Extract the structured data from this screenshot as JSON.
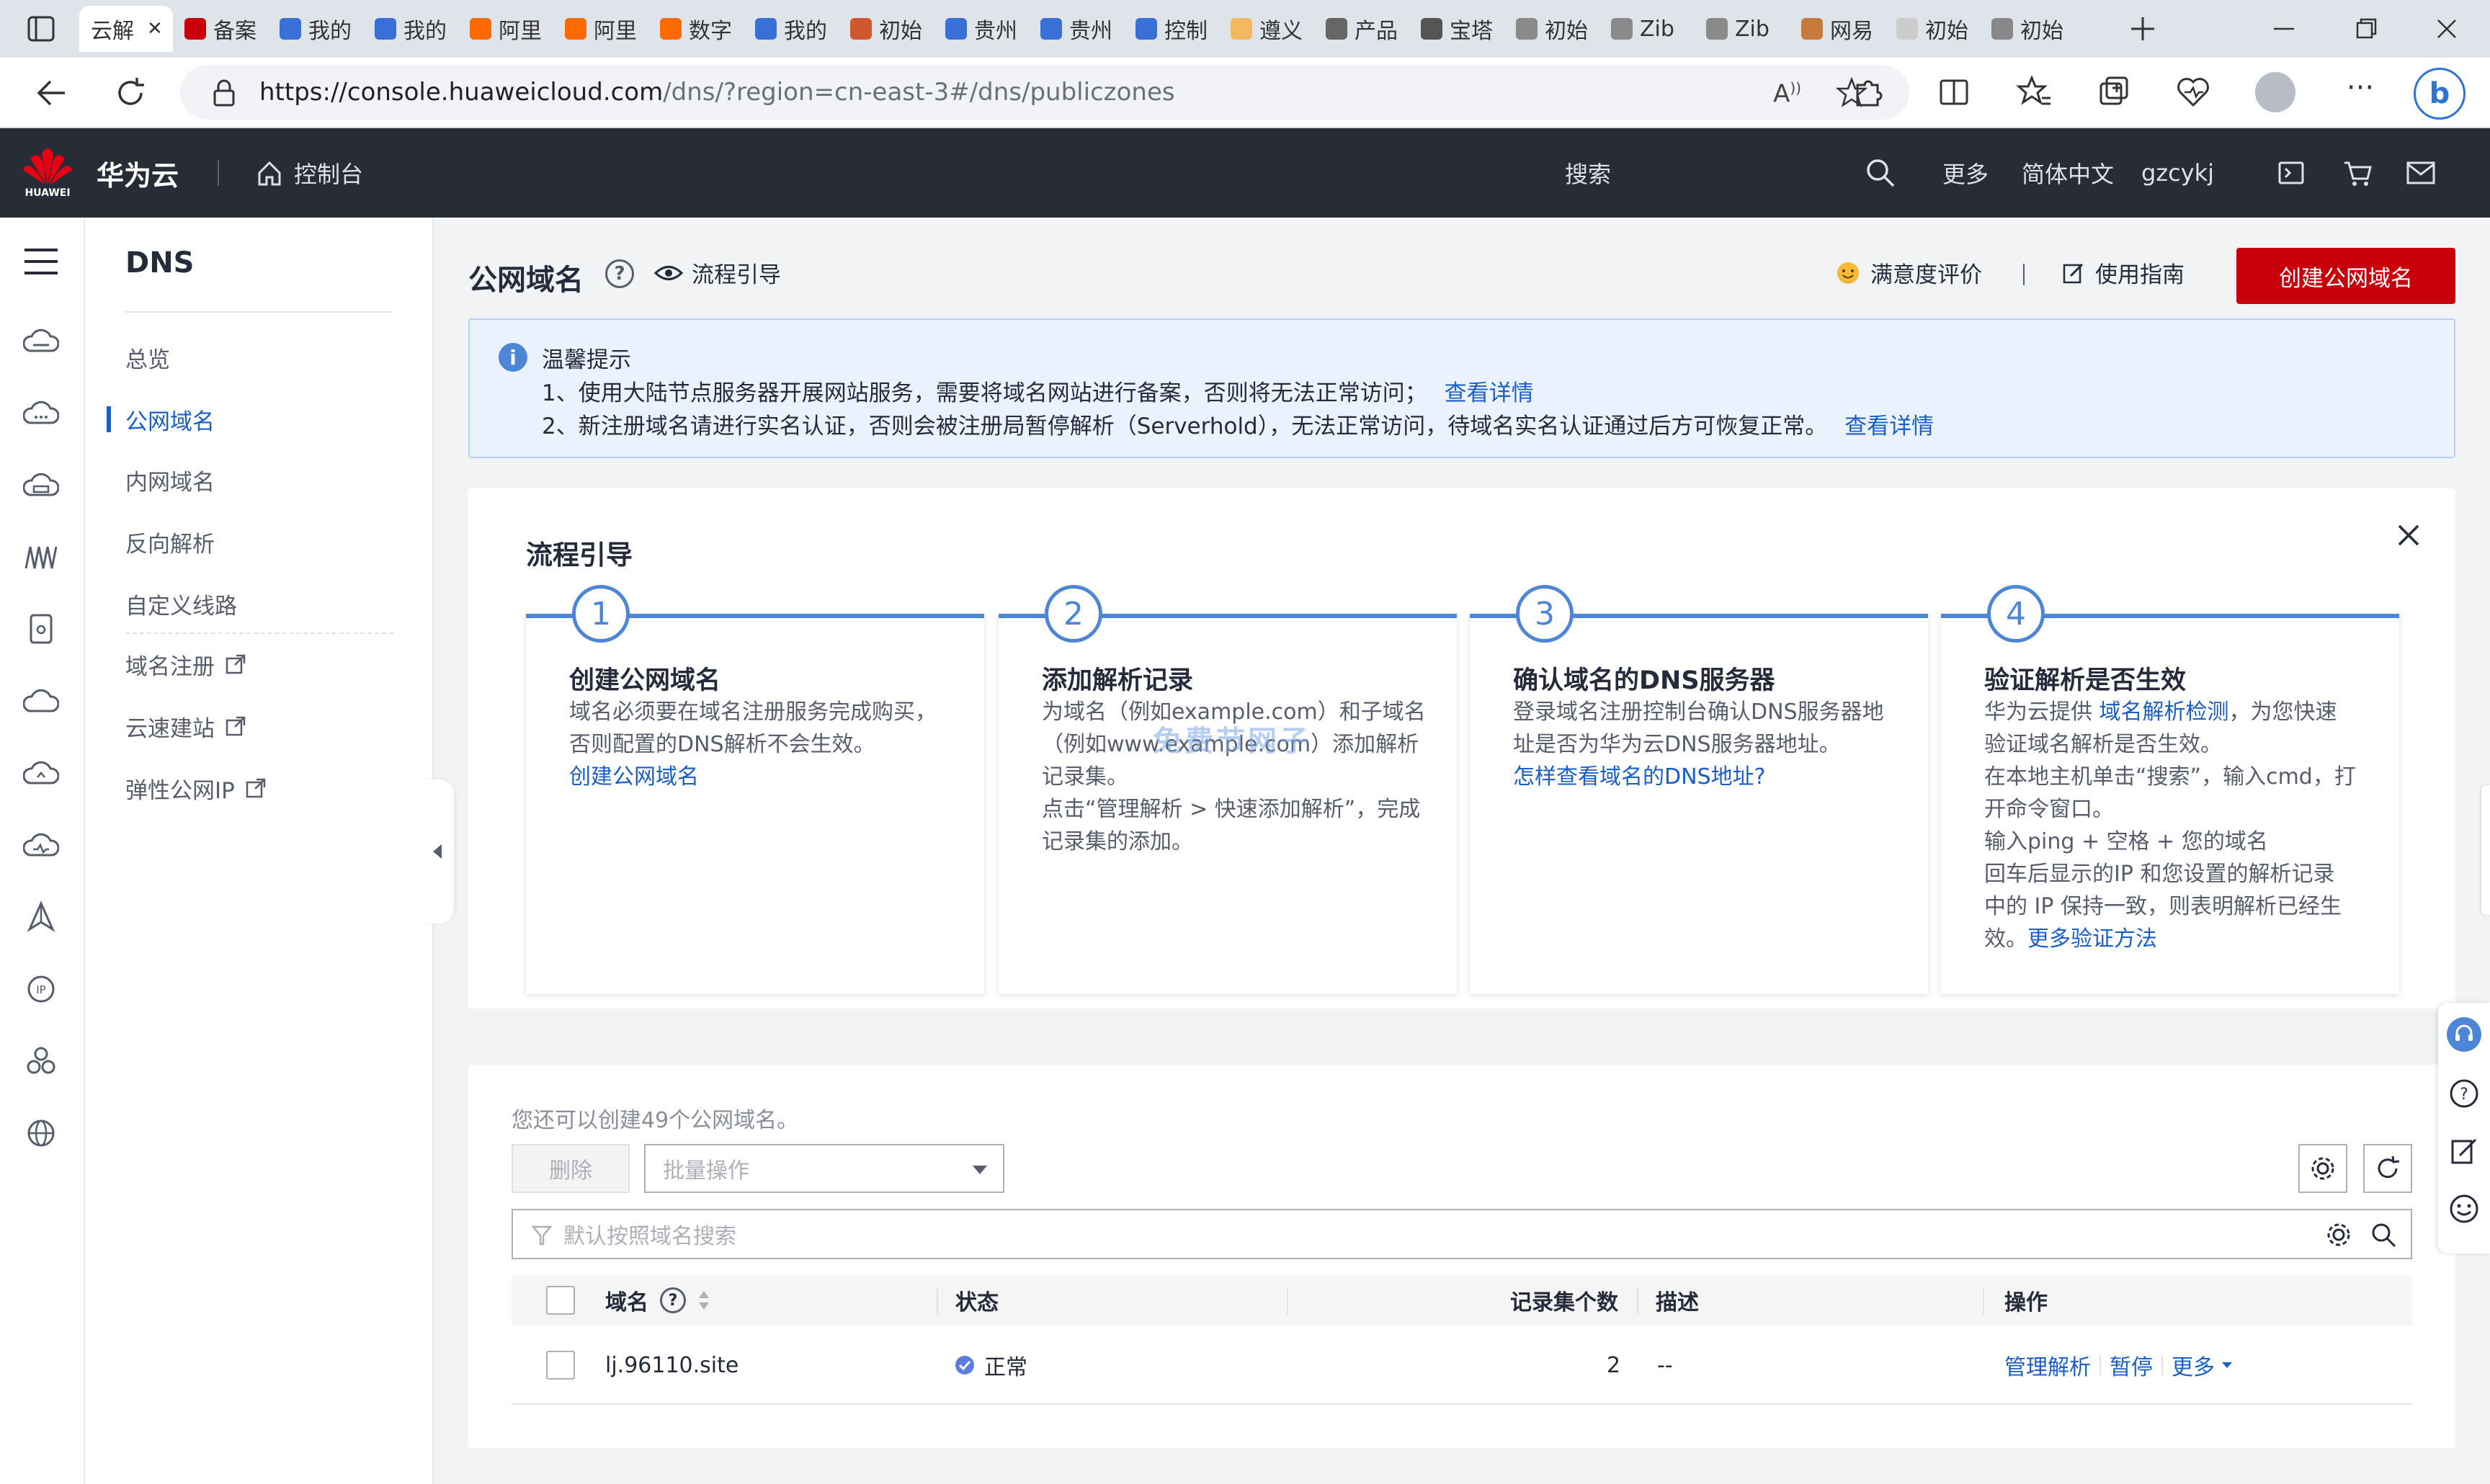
{
  "browser": {
    "tabs": [
      {
        "label": "云解",
        "color": "#c7000b",
        "active": true
      },
      {
        "label": "备案",
        "color": "#c7000b"
      },
      {
        "label": "我的",
        "color": "#3a6fd8"
      },
      {
        "label": "我的",
        "color": "#3a6fd8"
      },
      {
        "label": "阿里",
        "color": "#ff6a00"
      },
      {
        "label": "阿里",
        "color": "#ff6a00"
      },
      {
        "label": "数字",
        "color": "#ff6a00"
      },
      {
        "label": "我的",
        "color": "#3a6fd8"
      },
      {
        "label": "初始",
        "color": "#d0582e"
      },
      {
        "label": "贵州",
        "color": "#3a6fd8"
      },
      {
        "label": "贵州",
        "color": "#3a6fd8"
      },
      {
        "label": "控制",
        "color": "#3a6fd8"
      },
      {
        "label": "遵义",
        "color": "#f4b860"
      },
      {
        "label": "产品",
        "color": "#666666"
      },
      {
        "label": "宝塔",
        "color": "#555555"
      },
      {
        "label": "初始",
        "color": "#8a8a8a"
      },
      {
        "label": "Zib",
        "color": "#8a8a8a"
      },
      {
        "label": "Zib",
        "color": "#8a8a8a"
      },
      {
        "label": "网易",
        "color": "#c77a3b"
      },
      {
        "label": "初始",
        "color": "#cccccc"
      },
      {
        "label": "初始",
        "color": "#888888"
      }
    ],
    "url_host": "https://console.huaweicloud.com",
    "url_rest": "/dns/?region=cn-east-3#/dns/publiczones"
  },
  "topbar": {
    "logo_text": "HUAWEI",
    "brand": "华为云",
    "console": "控制台",
    "search": "搜索",
    "more": "更多",
    "language": "简体中文",
    "user": "gzcykj"
  },
  "sidebar": {
    "title": "DNS",
    "items": [
      {
        "label": "总览"
      },
      {
        "label": "公网域名",
        "active": true
      },
      {
        "label": "内网域名"
      },
      {
        "label": "反向解析"
      },
      {
        "label": "自定义线路"
      },
      {
        "label": "域名注册",
        "external": true
      },
      {
        "label": "云速建站",
        "external": true
      },
      {
        "label": "弹性公网IP",
        "external": true
      }
    ]
  },
  "header": {
    "title": "公网域名",
    "flow_guide": "流程引导",
    "satisfaction": "满意度评价",
    "guide": "使用指南",
    "create": "创建公网域名"
  },
  "notice": {
    "title": "温馨提示",
    "line1": "1、使用大陆节点服务器开展网站服务，需要将域名网站进行备案，否则将无法正常访问；",
    "line1_link": "查看详情",
    "line2": "2、新注册域名请进行实名认证，否则会被注册局暂停解析（Serverhold），无法正常访问，待域名实名认证通过后方可恢复正常。",
    "line2_link": "查看详情"
  },
  "flow": {
    "title": "流程引导",
    "steps": [
      {
        "num": "1",
        "title": "创建公网域名",
        "l1": "域名必须要在域名注册服务完成购买，",
        "l2": "否则配置的DNS解析不会生效。",
        "link": "创建公网域名"
      },
      {
        "num": "2",
        "title": "添加解析记录",
        "l1": "为域名（例如example.com）和子域名",
        "l2": "（例如www.example.com）添加解析",
        "l3": "记录集。",
        "l4": "点击“管理解析 > 快速添加解析”，完成",
        "l5": "记录集的添加。"
      },
      {
        "num": "3",
        "title": "确认域名的DNS服务器",
        "l1": "登录域名注册控制台确认DNS服务器地",
        "l2": "址是否为华为云DNS服务器地址。",
        "link": "怎样查看域名的DNS地址?"
      },
      {
        "num": "4",
        "title": "验证解析是否生效",
        "l1_pre": "华为云提供 ",
        "l1_link": "域名解析检测",
        "l1_post": "，为您快速",
        "l2": "验证域名解析是否生效。",
        "l3": "在本地主机单击“搜索”，输入cmd，打",
        "l4": "开命令窗口。",
        "l5": "输入ping + 空格 + 您的域名",
        "l6": "回车后显示的IP 和您设置的解析记录",
        "l7": "中的 IP 保持一致，则表明解析已经生",
        "l8_pre": "效。",
        "l8_link": "更多验证方法"
      }
    ]
  },
  "list": {
    "quota": "您还可以创建49个公网域名。",
    "delete": "删除",
    "batch": "批量操作",
    "search_placeholder": "默认按照域名搜索",
    "columns": {
      "domain": "域名",
      "status": "状态",
      "records": "记录集个数",
      "desc": "描述",
      "ops": "操作"
    },
    "rows": [
      {
        "domain": "lj.96110.site",
        "status": "正常",
        "records": "2",
        "desc": "--",
        "op1": "管理解析",
        "op2": "暂停",
        "op3": "更多"
      }
    ]
  },
  "watermark": "免费节网子",
  "colors": {
    "brand_red": "#c7000b",
    "link_blue": "#1a5ec8",
    "topbar_bg": "#272c36",
    "notice_bg": "#eaf3fd"
  }
}
